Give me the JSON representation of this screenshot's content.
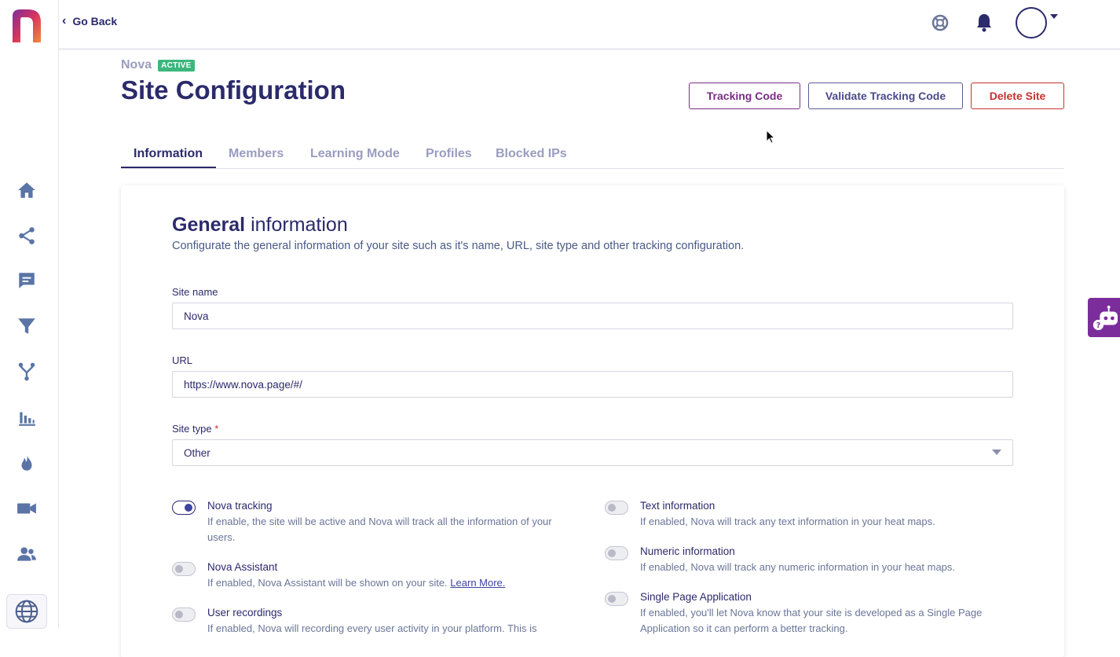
{
  "topbar": {
    "go_back": "Go Back"
  },
  "icons": {
    "logo": "nova-logo",
    "help": "lifebuoy-icon",
    "bell": "bell-icon",
    "avatar": "avatar",
    "sidebar": [
      "home-icon",
      "share-icon",
      "chat-icon",
      "filter-icon",
      "fork-icon",
      "bar-chart-icon",
      "flame-icon",
      "video-icon",
      "users-icon",
      "globe-icon"
    ]
  },
  "header": {
    "site_name": "Nova",
    "status_badge": "ACTIVE",
    "title": "Site Configuration",
    "buttons": {
      "tracking_code": "Tracking Code",
      "validate_tracking_code": "Validate Tracking Code",
      "delete_site": "Delete Site"
    }
  },
  "tabs": [
    {
      "label": "Information",
      "active": true
    },
    {
      "label": "Members",
      "active": false
    },
    {
      "label": "Learning Mode",
      "active": false
    },
    {
      "label": "Profiles",
      "active": false
    },
    {
      "label": "Blocked IPs",
      "active": false
    }
  ],
  "general": {
    "title_bold": "General",
    "title_rest": "information",
    "description": "Configurate the general information of your site such as it's name, URL, site type and other tracking configuration."
  },
  "form": {
    "site_name": {
      "label": "Site name",
      "value": "Nova"
    },
    "url": {
      "label": "URL",
      "value": "https://www.nova.page/#/"
    },
    "site_type": {
      "label": "Site type",
      "required_mark": "*",
      "value": "Other"
    }
  },
  "options_left": [
    {
      "title": "Nova tracking",
      "enabled": true,
      "description": "If enable, the site will be active and Nova will track all the information of your users."
    },
    {
      "title": "Nova Assistant",
      "enabled": false,
      "description": "If enabled, Nova Assistant will be shown on your site.",
      "link": "Learn More."
    },
    {
      "title": "User recordings",
      "enabled": false,
      "description": "If enabled, Nova will recording every user activity in your platform. This is"
    }
  ],
  "options_right": [
    {
      "title": "Text information",
      "enabled": false,
      "description": "If enabled, Nova will track any text information in your heat maps."
    },
    {
      "title": "Numeric information",
      "enabled": false,
      "description": "If enabled, Nova will track any numeric information in your heat maps."
    },
    {
      "title": "Single Page Application",
      "enabled": false,
      "description": "If enabled, you'll let Nova know that your site is developed as a Single Page Application so it can perform a better tracking."
    }
  ],
  "colors": {
    "primary": "#2b2a6b",
    "accent_purple": "#7b2d86",
    "danger": "#c5322f",
    "badge_green": "#3bb77e"
  }
}
